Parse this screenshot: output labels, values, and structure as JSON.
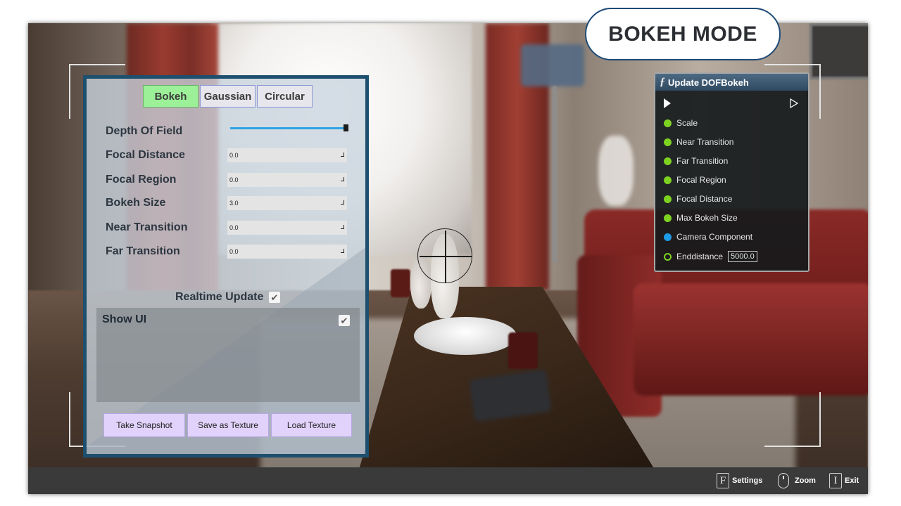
{
  "mode_badge": {
    "label": "BOKEH MODE"
  },
  "panel": {
    "tabs": [
      {
        "label": "Bokeh",
        "active": true
      },
      {
        "label": "Gaussian",
        "active": false
      },
      {
        "label": "Circular",
        "active": false
      }
    ],
    "depth_of_field": {
      "label": "Depth Of Field",
      "slider_fraction": 1.0
    },
    "fields": [
      {
        "label": "Focal Distance",
        "value": "0.0"
      },
      {
        "label": "Focal Region",
        "value": "0.0"
      },
      {
        "label": "Bokeh Size",
        "value": "3.0"
      },
      {
        "label": "Near Transition",
        "value": "0.0"
      },
      {
        "label": "Far Transition",
        "value": "0.0"
      }
    ],
    "realtime_update": {
      "label": "Realtime Update",
      "checked": true
    },
    "show_ui": {
      "label": "Show UI",
      "checked": true
    },
    "buttons": {
      "snapshot": "Take Snapshot",
      "save_texture": "Save as Texture",
      "load_texture": "Load Texture"
    }
  },
  "node": {
    "title": "Update DOFBokeh",
    "function_icon": "function-icon",
    "pins": [
      {
        "label": "Scale",
        "color": "#7ed321"
      },
      {
        "label": "Near Transition",
        "color": "#7ed321"
      },
      {
        "label": "Far Transition",
        "color": "#7ed321"
      },
      {
        "label": "Focal Region",
        "color": "#7ed321"
      },
      {
        "label": "Focal Distance",
        "color": "#7ed321"
      },
      {
        "label": "Max Bokeh Size",
        "color": "#7ed321"
      },
      {
        "label": "Camera Component",
        "color": "#1e9be6"
      }
    ],
    "end_distance": {
      "label": "Enddistance",
      "value": "5000.0"
    }
  },
  "bottom_bar": {
    "settings": {
      "key": "F",
      "label": "Settings"
    },
    "zoom": {
      "icon": "mouse-icon",
      "label": "Zoom"
    },
    "exit": {
      "key": "I",
      "label": "Exit"
    }
  },
  "colors": {
    "panel_border": "#1d4f6e",
    "active_tab": "#9cf098",
    "slider": "#2da2e6",
    "action_button": "#e1d2fb",
    "pin_float": "#7ed321",
    "pin_object": "#1e9be6"
  }
}
